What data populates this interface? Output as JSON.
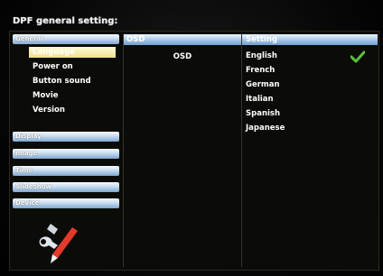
{
  "title": "DPF general setting:",
  "left": {
    "categories": [
      "General",
      "Display",
      "Image",
      "Time",
      "Slideshow",
      "Device"
    ],
    "general_items": [
      "Language",
      "Power on",
      "Button sound",
      "Movie",
      "Version"
    ],
    "selected_item": "Language"
  },
  "middle": {
    "header": "OSD",
    "item": "OSD"
  },
  "right": {
    "header": "Setting",
    "options": [
      "English",
      "French",
      "German",
      "Italian",
      "Spanish",
      "Japanese"
    ],
    "selected": "English"
  },
  "colors": {
    "header_blue": "#7fa7cf",
    "selection_yellow": "#f0e08a",
    "check_green": "#57c23a"
  },
  "icons": {
    "check": "check-icon",
    "logo": "tools-logo-icon"
  }
}
